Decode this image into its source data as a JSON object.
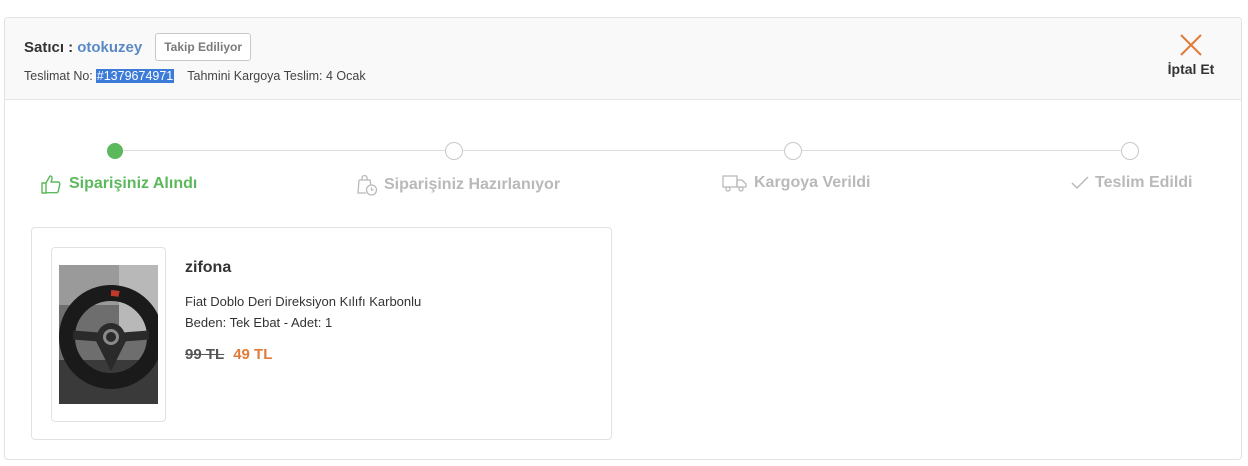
{
  "header": {
    "seller_label": "Satıcı :",
    "seller_name": "otokuzey",
    "follow_label": "Takip Ediliyor",
    "delivery_label": "Teslimat No:",
    "delivery_no": "#1379674971",
    "eta": "Tahmini Kargoya Teslim: 4 Ocak",
    "cancel_label": "İptal Et",
    "accent_color": "#e07b3a"
  },
  "steps": [
    {
      "label": "Siparişiniz Alındı",
      "icon": "thumbs-up-icon",
      "done": true
    },
    {
      "label": "Siparişiniz Hazırlanıyor",
      "icon": "bag-clock-icon",
      "done": false
    },
    {
      "label": "Kargoya Verildi",
      "icon": "truck-icon",
      "done": false
    },
    {
      "label": "Teslim Edildi",
      "icon": "check-icon",
      "done": false
    }
  ],
  "product": {
    "brand": "zifona",
    "name": "Fiat Doblo Deri Direksiyon Kılıfı Karbonlu",
    "variant": "Beden: Tek Ebat - Adet: 1",
    "old_price": "99 TL",
    "new_price": "49 TL",
    "image": "steering-wheel-cover-image"
  },
  "colors": {
    "success": "#5cb85c",
    "link": "#5a8ac6",
    "price": "#e07b3a",
    "muted": "#b9b9b9"
  }
}
